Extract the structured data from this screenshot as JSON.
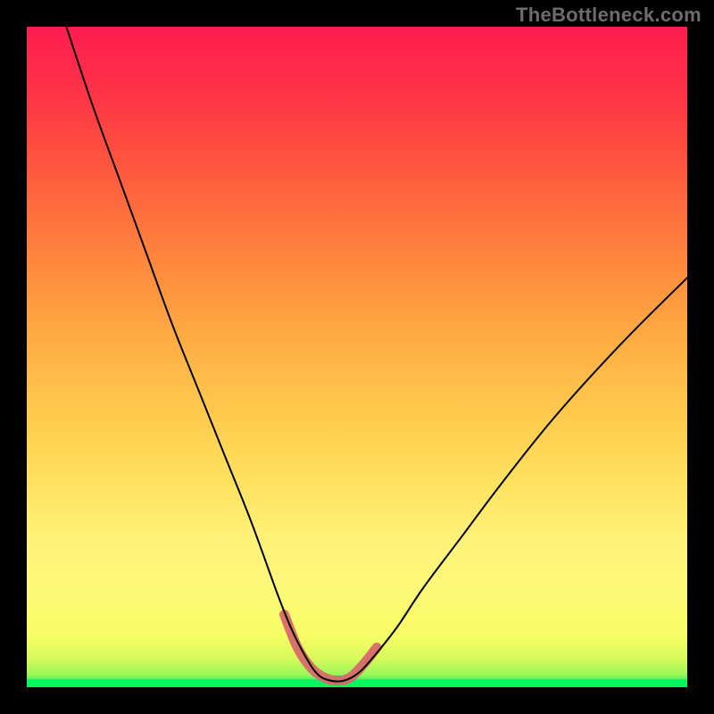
{
  "watermark": "TheBottleneck.com",
  "colors": {
    "frame_bg": "#000000",
    "curve": "#000000",
    "highlight": "#d86a6a",
    "gradient_top": "#fd1d50",
    "gradient_mid": "#ffe462",
    "gradient_low": "#00f562"
  },
  "chart_data": {
    "type": "line",
    "title": "",
    "xlabel": "",
    "ylabel": "",
    "xlim": [
      0,
      100
    ],
    "ylim": [
      0,
      100
    ],
    "grid": false,
    "legend": false,
    "description": "Bottleneck chart: V-shaped bottleneck curve on red-to-green gradient. Y encodes bottleneck % (red high, green low). Minimum near x≈43–50 at y≈1 highlighted in salmon.",
    "series": [
      {
        "name": "bottleneck-curve",
        "type": "line",
        "x": [
          6,
          10,
          14,
          18,
          22,
          26,
          30,
          34,
          38,
          40,
          42,
          44,
          46,
          48,
          50,
          52,
          56,
          60,
          66,
          72,
          80,
          90,
          100
        ],
        "values": [
          100,
          88,
          77,
          66,
          55,
          45,
          35,
          25,
          14,
          9,
          5,
          2,
          1,
          1,
          2,
          4,
          9,
          15,
          23,
          31,
          41,
          52,
          62
        ]
      },
      {
        "name": "optimal-zone-highlight",
        "type": "line",
        "x": [
          39,
          41,
          43,
          45,
          47,
          49,
          51,
          53
        ],
        "values": [
          11,
          6,
          3,
          1.5,
          1,
          1.5,
          3.5,
          6
        ]
      }
    ]
  }
}
